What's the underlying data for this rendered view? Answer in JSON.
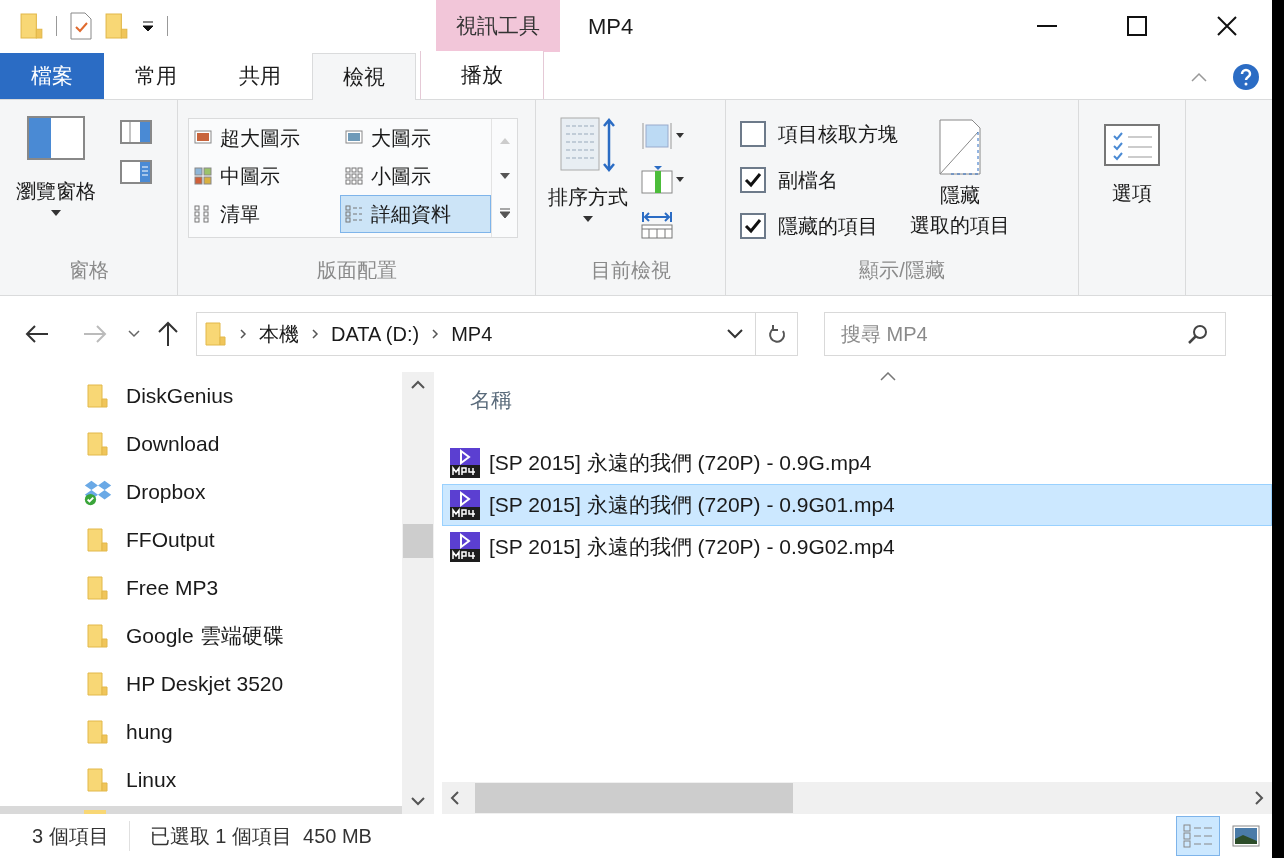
{
  "window": {
    "title": "MP4",
    "context_group": "視訊工具"
  },
  "ribbon_tabs": [
    {
      "label": "檔案",
      "kind": "file",
      "selected": false
    },
    {
      "label": "常用",
      "kind": "normal",
      "selected": false
    },
    {
      "label": "共用",
      "kind": "normal",
      "selected": false
    },
    {
      "label": "檢視",
      "kind": "normal",
      "selected": true
    },
    {
      "label": "播放",
      "kind": "contextual",
      "selected": false
    }
  ],
  "ribbon": {
    "panes": {
      "button": "瀏覽窗格",
      "group": "窗格"
    },
    "layout": {
      "group": "版面配置",
      "options": [
        {
          "label": "超大圖示",
          "kind": "xl",
          "selected": false
        },
        {
          "label": "大圖示",
          "kind": "large",
          "selected": false
        },
        {
          "label": "中圖示",
          "kind": "medium",
          "selected": false
        },
        {
          "label": "小圖示",
          "kind": "small",
          "selected": false
        },
        {
          "label": "清單",
          "kind": "list",
          "selected": false
        },
        {
          "label": "詳細資料",
          "kind": "details",
          "selected": true
        }
      ]
    },
    "current_view": {
      "button": "排序方式",
      "group": "目前檢視"
    },
    "show_hide": {
      "group": "顯示/隱藏",
      "checkboxes": [
        {
          "label": "項目核取方塊",
          "checked": false
        },
        {
          "label": "副檔名",
          "checked": true
        },
        {
          "label": "隱藏的項目",
          "checked": true
        }
      ],
      "hide_button": [
        "隱藏",
        "選取的項目"
      ]
    },
    "options": {
      "button": "選項"
    }
  },
  "address": {
    "path": [
      "本機",
      "DATA (D:)",
      "MP4"
    ]
  },
  "search": {
    "placeholder": "搜尋 MP4"
  },
  "nav": {
    "items": [
      {
        "name": "DiskGenius",
        "kind": "folder"
      },
      {
        "name": "Download",
        "kind": "folder"
      },
      {
        "name": "Dropbox",
        "kind": "dropbox"
      },
      {
        "name": "FFOutput",
        "kind": "folder"
      },
      {
        "name": "Free MP3",
        "kind": "folder"
      },
      {
        "name": "Google 雲端硬碟",
        "kind": "folder"
      },
      {
        "name": "HP Deskjet 3520",
        "kind": "folder"
      },
      {
        "name": "hung",
        "kind": "folder"
      },
      {
        "name": "Linux",
        "kind": "folder"
      }
    ]
  },
  "files": {
    "column": "名稱",
    "items": [
      {
        "name": "[SP 2015] 永遠的我們 (720P) - 0.9G.mp4",
        "selected": false
      },
      {
        "name": "[SP 2015] 永遠的我們 (720P) - 0.9G01.mp4",
        "selected": true
      },
      {
        "name": "[SP 2015] 永遠的我們 (720P) - 0.9G02.mp4",
        "selected": false
      }
    ]
  },
  "status": {
    "count": "3 個項目",
    "selection": "已選取 1 個項目  450 MB"
  },
  "view_buttons": [
    {
      "kind": "details",
      "selected": true
    },
    {
      "kind": "thumbnails",
      "selected": false
    }
  ]
}
